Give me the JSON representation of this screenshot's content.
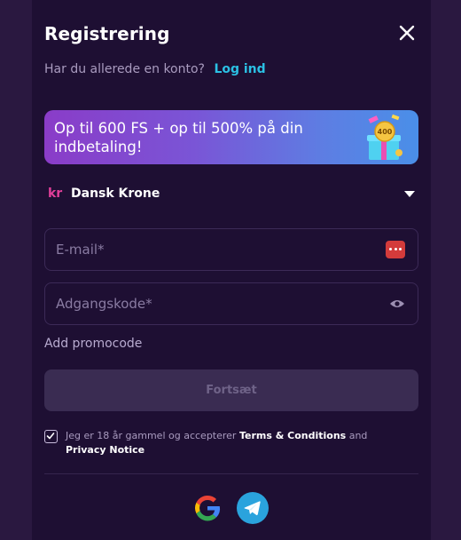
{
  "modal": {
    "title": "Registrering",
    "login_prompt": "Har du allerede en konto?",
    "login_link": "Log ind"
  },
  "banner": {
    "text": "Op til 600 FS + op til 500% på din indbetaling!",
    "gift_badge": "400"
  },
  "currency": {
    "symbol": "kr",
    "label": "Dansk Krone"
  },
  "form": {
    "email_placeholder": "E-mail*",
    "email_value": "",
    "password_placeholder": "Adgangskode*",
    "password_value": "",
    "promo_link": "Add promocode",
    "submit_label": "Fortsæt"
  },
  "terms": {
    "prefix": "Jeg er 18 år gammel og accepterer",
    "terms_link": "Terms & Conditions",
    "and": "and",
    "privacy_link": "Privacy Notice",
    "checked": true
  },
  "social": {
    "providers": [
      "google-icon",
      "telegram-icon"
    ]
  },
  "colors": {
    "background": "#2a1840",
    "panel": "#1e0f33",
    "link": "#2bc0e4",
    "banner_start": "#8a3cc8",
    "banner_end": "#4a8fe8",
    "submit_disabled": "#3a2c52"
  }
}
